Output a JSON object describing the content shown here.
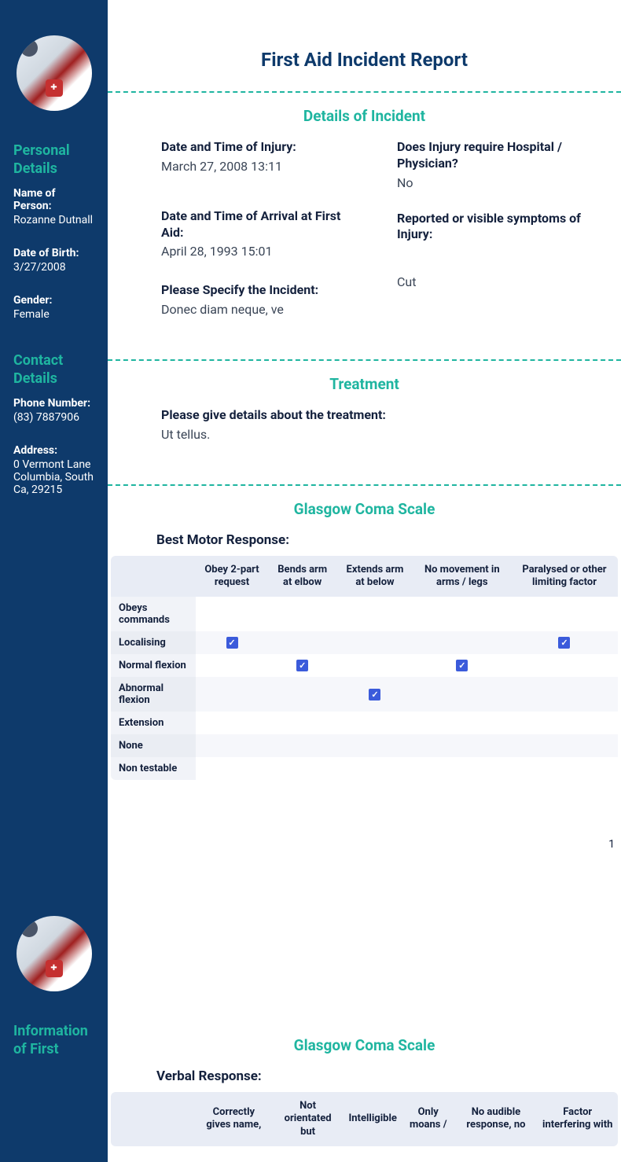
{
  "page_title": "First Aid Incident Report",
  "sidebar": {
    "personal_heading": "Personal Details",
    "contact_heading": "Contact Details",
    "info_heading": "Information of First",
    "name_label": "Name of Person:",
    "name_value": "Rozanne Dutnall",
    "dob_label": "Date of Birth:",
    "dob_value": "3/27/2008",
    "gender_label": "Gender:",
    "gender_value": "Female",
    "phone_label": "Phone Number:",
    "phone_value": "(83) 7887906",
    "address_label": "Address:",
    "address_value": "0 Vermont Lane Columbia, South Ca, 29215"
  },
  "details": {
    "section_title": "Details of Incident",
    "injury_time_label": "Date and Time of Injury:",
    "injury_time_value": "March 27, 2008 13:11",
    "arrival_label": "Date and Time of Arrival at First Aid:",
    "arrival_value": "April 28, 1993 15:01",
    "specify_label": "Please Specify the Incident:",
    "specify_value": "Donec diam neque, ve",
    "hospital_label": "Does Injury require Hospital / Physician?",
    "hospital_value": "No",
    "symptoms_label": "Reported or visible symptoms of Injury:",
    "symptoms_value": "Cut"
  },
  "treatment": {
    "section_title": "Treatment",
    "details_label": "Please give details about the treatment:",
    "details_value": "Ut tellus."
  },
  "gcs": {
    "section_title": "Glasgow Coma Scale",
    "motor_label": "Best Motor Response:",
    "motor_columns": [
      "",
      "Obey 2-part request",
      "Bends arm at elbow",
      "Extends arm at below",
      "No movement in arms / legs",
      "Paralysed or other limiting factor"
    ],
    "motor_rows": [
      {
        "label": "Obeys commands",
        "checks": [
          false,
          false,
          false,
          false,
          false
        ]
      },
      {
        "label": "Localising",
        "checks": [
          true,
          false,
          false,
          false,
          true
        ]
      },
      {
        "label": "Normal flexion",
        "checks": [
          false,
          true,
          false,
          true,
          false
        ]
      },
      {
        "label": "Abnormal flexion",
        "checks": [
          false,
          false,
          true,
          false,
          false
        ]
      },
      {
        "label": "Extension",
        "checks": [
          false,
          false,
          false,
          false,
          false
        ]
      },
      {
        "label": "None",
        "checks": [
          false,
          false,
          false,
          false,
          false
        ]
      },
      {
        "label": "Non testable",
        "checks": [
          false,
          false,
          false,
          false,
          false
        ]
      }
    ],
    "verbal_label": "Verbal Response:",
    "verbal_columns": [
      "",
      "Correctly gives name,",
      "Not orientated but",
      "Intelligible",
      "Only moans /",
      "No audible response, no",
      "Factor interfering with"
    ]
  },
  "page_number_1": "1"
}
